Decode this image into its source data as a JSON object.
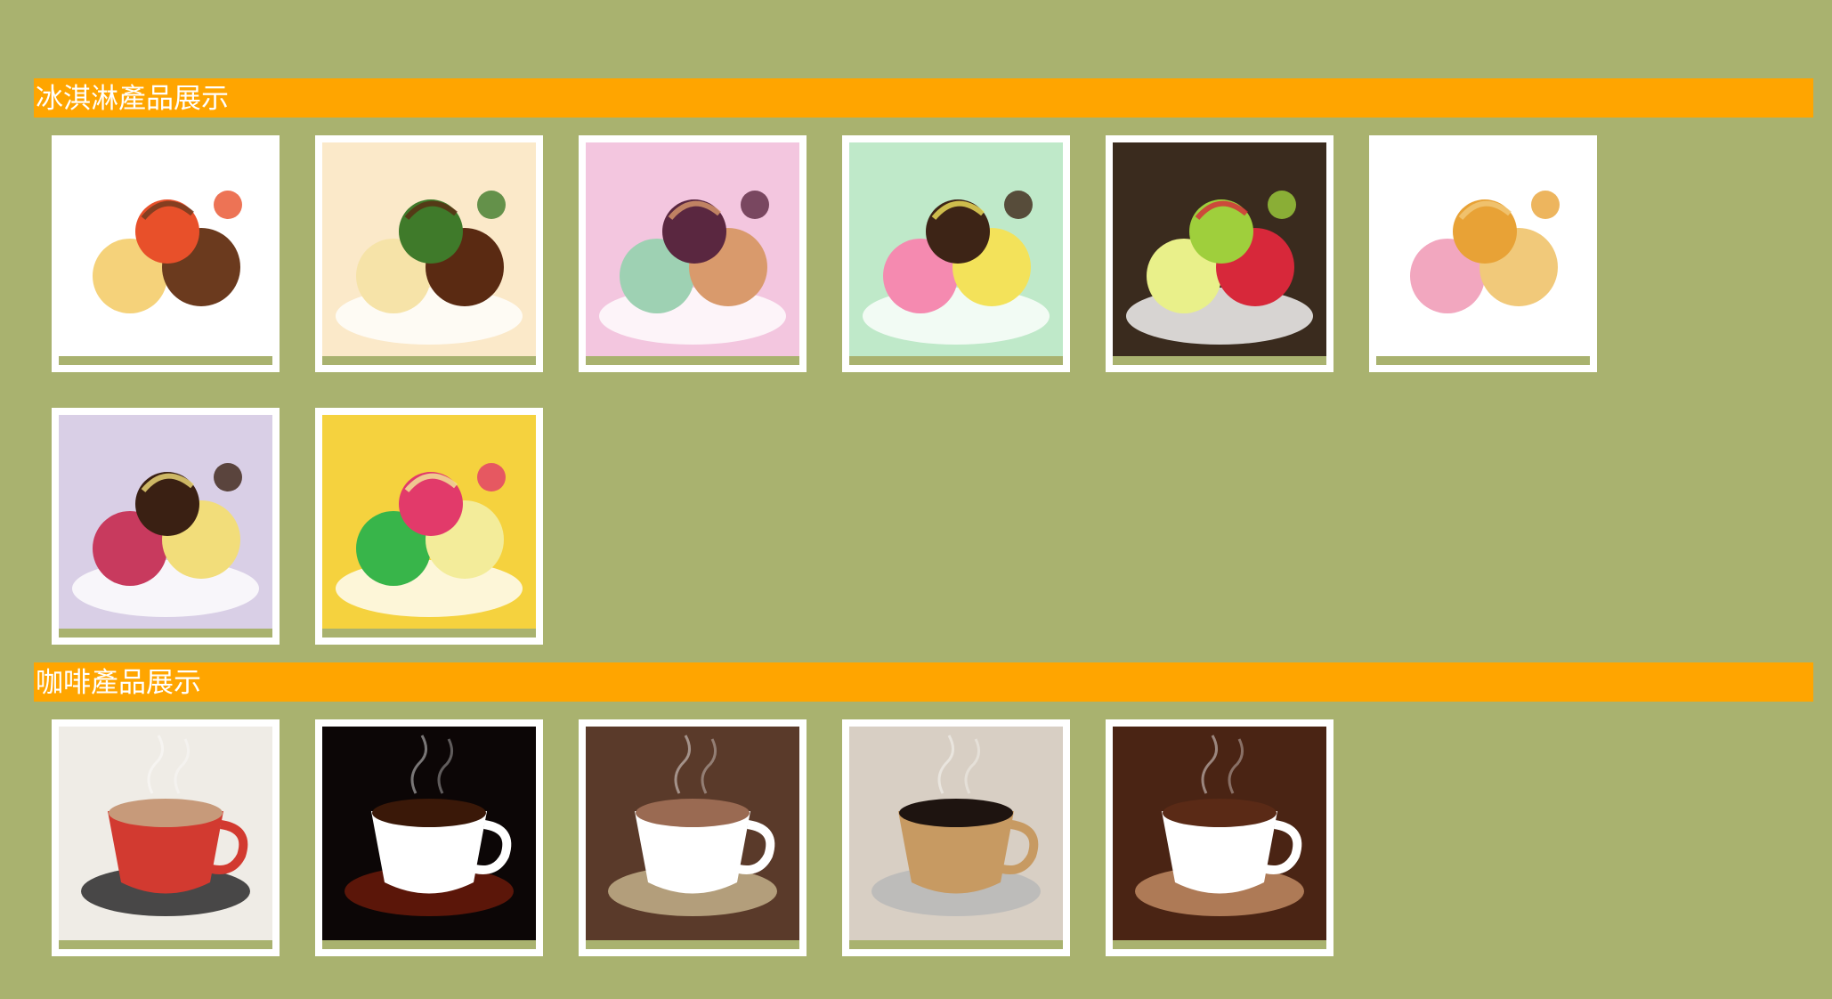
{
  "sections": [
    {
      "title": "冰淇淋產品展示",
      "items": [
        {
          "name": "chocolate-sundae-photo",
          "colors": {
            "bg": "#ffffff",
            "a": "#6b3a1e",
            "b": "#f5d27a",
            "c": "#e8502a"
          }
        },
        {
          "name": "banana-split-photo",
          "colors": {
            "bg": "#fbe9c9",
            "a": "#5a2a12",
            "b": "#f6e3a8",
            "c": "#3f7a2a"
          }
        },
        {
          "name": "mushroom-ice-cream-photo",
          "colors": {
            "bg": "#f3c6df",
            "a": "#d99a6c",
            "b": "#9ed1b3",
            "c": "#5a2740"
          }
        },
        {
          "name": "fruit-sorbet-bowl-photo",
          "colors": {
            "bg": "#bfe9c9",
            "a": "#f3e25a",
            "b": "#f58ab0",
            "c": "#3d2416"
          }
        },
        {
          "name": "strawberry-jelly-dessert-photo",
          "colors": {
            "bg": "#3a2b1e",
            "a": "#d7283a",
            "b": "#e9f08a",
            "c": "#9fcf3c"
          }
        },
        {
          "name": "waffle-ice-cream-photo",
          "colors": {
            "bg": "#ffffff",
            "a": "#f1c97a",
            "b": "#f2a7bf",
            "c": "#e8a236"
          }
        },
        {
          "name": "cupcake-ice-cream-photo",
          "colors": {
            "bg": "#d9cfe6",
            "a": "#f2dd7a",
            "b": "#c83a5e",
            "c": "#3a2013"
          }
        },
        {
          "name": "candy-egg-dessert-photo",
          "colors": {
            "bg": "#f5d23e",
            "a": "#f3ec9a",
            "b": "#38b54a",
            "c": "#e23a6a"
          }
        }
      ]
    },
    {
      "title": "咖啡產品展示",
      "items": [
        {
          "name": "red-cup-coffee-photo",
          "colors": {
            "bg": "#efece6",
            "a": "#d23a30",
            "b": "#c79a7a",
            "c": "#2a2a2a"
          }
        },
        {
          "name": "black-coffee-cup-photo",
          "colors": {
            "bg": "#0c0606",
            "a": "#ffffff",
            "b": "#3a1808",
            "c": "#6a1a0a"
          }
        },
        {
          "name": "hot-chocolate-marshmallow-photo",
          "colors": {
            "bg": "#5a3a2a",
            "a": "#ffffff",
            "b": "#9a6a52",
            "c": "#c3b08a"
          }
        },
        {
          "name": "espresso-glass-photo",
          "colors": {
            "bg": "#d8cfc4",
            "a": "#c79a62",
            "b": "#1e1410",
            "c": "#b8b8b8"
          }
        },
        {
          "name": "coffee-beans-cup-photo",
          "colors": {
            "bg": "#4a2414",
            "a": "#ffffff",
            "b": "#5a2a16",
            "c": "#c08a62"
          }
        }
      ]
    }
  ]
}
